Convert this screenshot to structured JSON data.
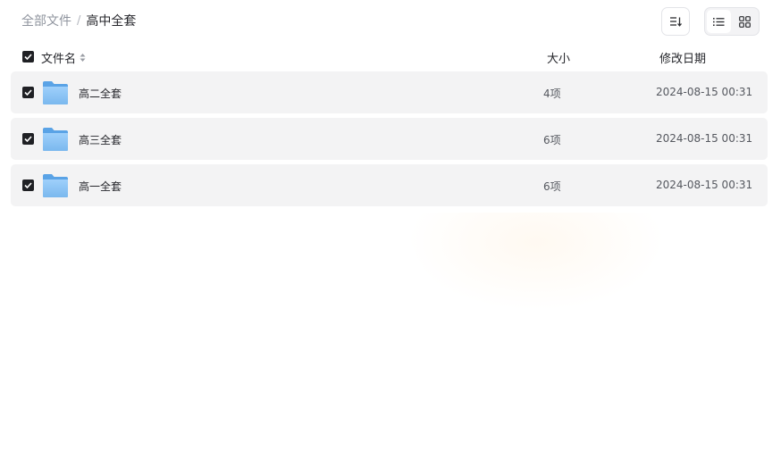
{
  "breadcrumb": {
    "root": "全部文件",
    "separator": "/",
    "current": "高中全套"
  },
  "toolbar": {
    "sort_icon": "sort-icon",
    "list_view_icon": "list-view-icon",
    "grid_view_icon": "grid-view-icon",
    "active_view": "list"
  },
  "table": {
    "headers": {
      "name": "文件名",
      "size": "大小",
      "date": "修改日期"
    },
    "select_all_checked": true,
    "rows": [
      {
        "name": "高二全套",
        "size": "4项",
        "date": "2024-08-15 00:31",
        "checked": true,
        "icon": "folder-icon"
      },
      {
        "name": "高三全套",
        "size": "6项",
        "date": "2024-08-15 00:31",
        "checked": true,
        "icon": "folder-icon"
      },
      {
        "name": "高一全套",
        "size": "6项",
        "date": "2024-08-15 00:31",
        "checked": true,
        "icon": "folder-icon"
      }
    ]
  },
  "colors": {
    "row_background": "#f3f3f4",
    "checkbox": "#1f2024",
    "folder": "#7ab8ee",
    "muted_text": "#8f949e"
  }
}
